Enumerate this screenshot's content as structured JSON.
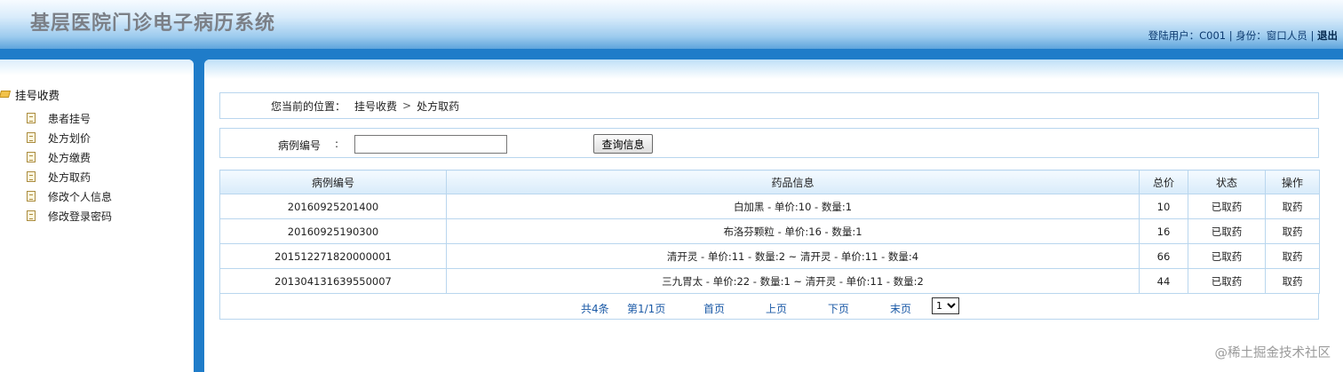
{
  "header": {
    "title": "基层医院门诊电子病历系统",
    "user_info": "登陆用户：C001 | 身份：窗口人员 | ",
    "logout": "退出"
  },
  "sidebar": {
    "root": "挂号收费",
    "items": [
      {
        "label": "患者挂号"
      },
      {
        "label": "处方划价"
      },
      {
        "label": "处方缴费"
      },
      {
        "label": "处方取药"
      },
      {
        "label": "修改个人信息"
      },
      {
        "label": "修改登录密码"
      }
    ]
  },
  "breadcrumb": {
    "prefix": "您当前的位置：",
    "level1": "挂号收费",
    "separator": ">",
    "level2": "处方取药"
  },
  "search": {
    "label": "病例编号",
    "colon": ":",
    "value": "",
    "placeholder": "",
    "button": "查询信息"
  },
  "table": {
    "headers": [
      "病例编号",
      "药品信息",
      "总价",
      "状态",
      "操作"
    ],
    "rows": [
      {
        "id": "20160925201400",
        "drugs": "白加黑 - 单价:10 - 数量:1",
        "total": "10",
        "status": "已取药",
        "action": "取药"
      },
      {
        "id": "20160925190300",
        "drugs": "布洛芬颗粒 - 单价:16 - 数量:1",
        "total": "16",
        "status": "已取药",
        "action": "取药"
      },
      {
        "id": "201512271820000001",
        "drugs": "清开灵 - 单价:11 - 数量:2 ~ 清开灵 - 单价:11 - 数量:4",
        "total": "66",
        "status": "已取药",
        "action": "取药"
      },
      {
        "id": "201304131639550007",
        "drugs": "三九胃太 - 单价:22 - 数量:1 ~ 清开灵 - 单价:11 - 数量:2",
        "total": "44",
        "status": "已取药",
        "action": "取药"
      }
    ]
  },
  "pager": {
    "total": "共4条",
    "page": "第1/1页",
    "first": "首页",
    "prev": "上页",
    "next": "下页",
    "last": "末页",
    "selected": "1"
  },
  "watermark": "@稀土掘金技术社区"
}
